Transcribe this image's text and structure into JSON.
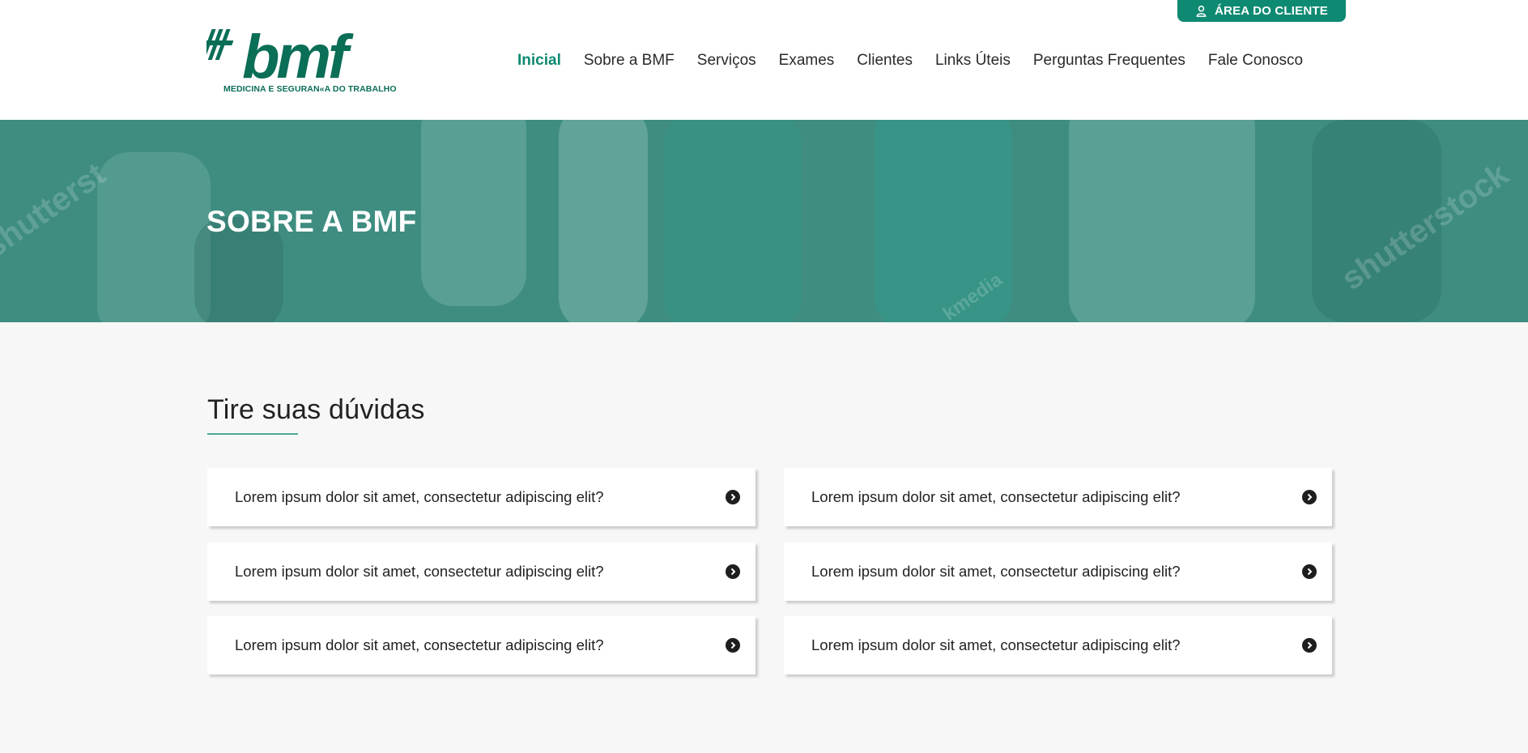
{
  "header": {
    "client_area_label": "ÁREA DO CLIENTE",
    "logo_text": "bmf",
    "logo_tagline": "MEDICINA E SEGURAN«A DO TRABALHO",
    "nav": [
      {
        "label": "Inicial",
        "active": true
      },
      {
        "label": "Sobre a BMF",
        "active": false
      },
      {
        "label": "Serviços",
        "active": false
      },
      {
        "label": "Exames",
        "active": false
      },
      {
        "label": "Clientes",
        "active": false
      },
      {
        "label": "Links Úteis",
        "active": false
      },
      {
        "label": "Perguntas Frequentes",
        "active": false
      },
      {
        "label": "Fale Conosco",
        "active": false
      }
    ]
  },
  "hero": {
    "title": "SOBRE A BMF",
    "watermark_1": "shutterst",
    "watermark_2": "shutterstock",
    "watermark_3": "kmedia"
  },
  "faq": {
    "title": "Tire suas dúvidas",
    "items": [
      {
        "question": "Lorem ipsum dolor sit amet, consectetur adipiscing elit?"
      },
      {
        "question": "Lorem ipsum dolor sit amet, consectetur adipiscing elit?"
      },
      {
        "question": "Lorem ipsum dolor sit amet, consectetur adipiscing elit?"
      },
      {
        "question": "Lorem ipsum dolor sit amet, consectetur adipiscing elit?"
      },
      {
        "question": "Lorem ipsum dolor sit amet, consectetur adipiscing elit?"
      },
      {
        "question": "Lorem ipsum dolor sit amet, consectetur adipiscing elit?"
      }
    ],
    "item_icon": "chevron-right-circle-icon"
  },
  "colors": {
    "brand": "#0e8a72",
    "hero_overlay": "#3e8d80",
    "background": "#f7f7f7"
  }
}
